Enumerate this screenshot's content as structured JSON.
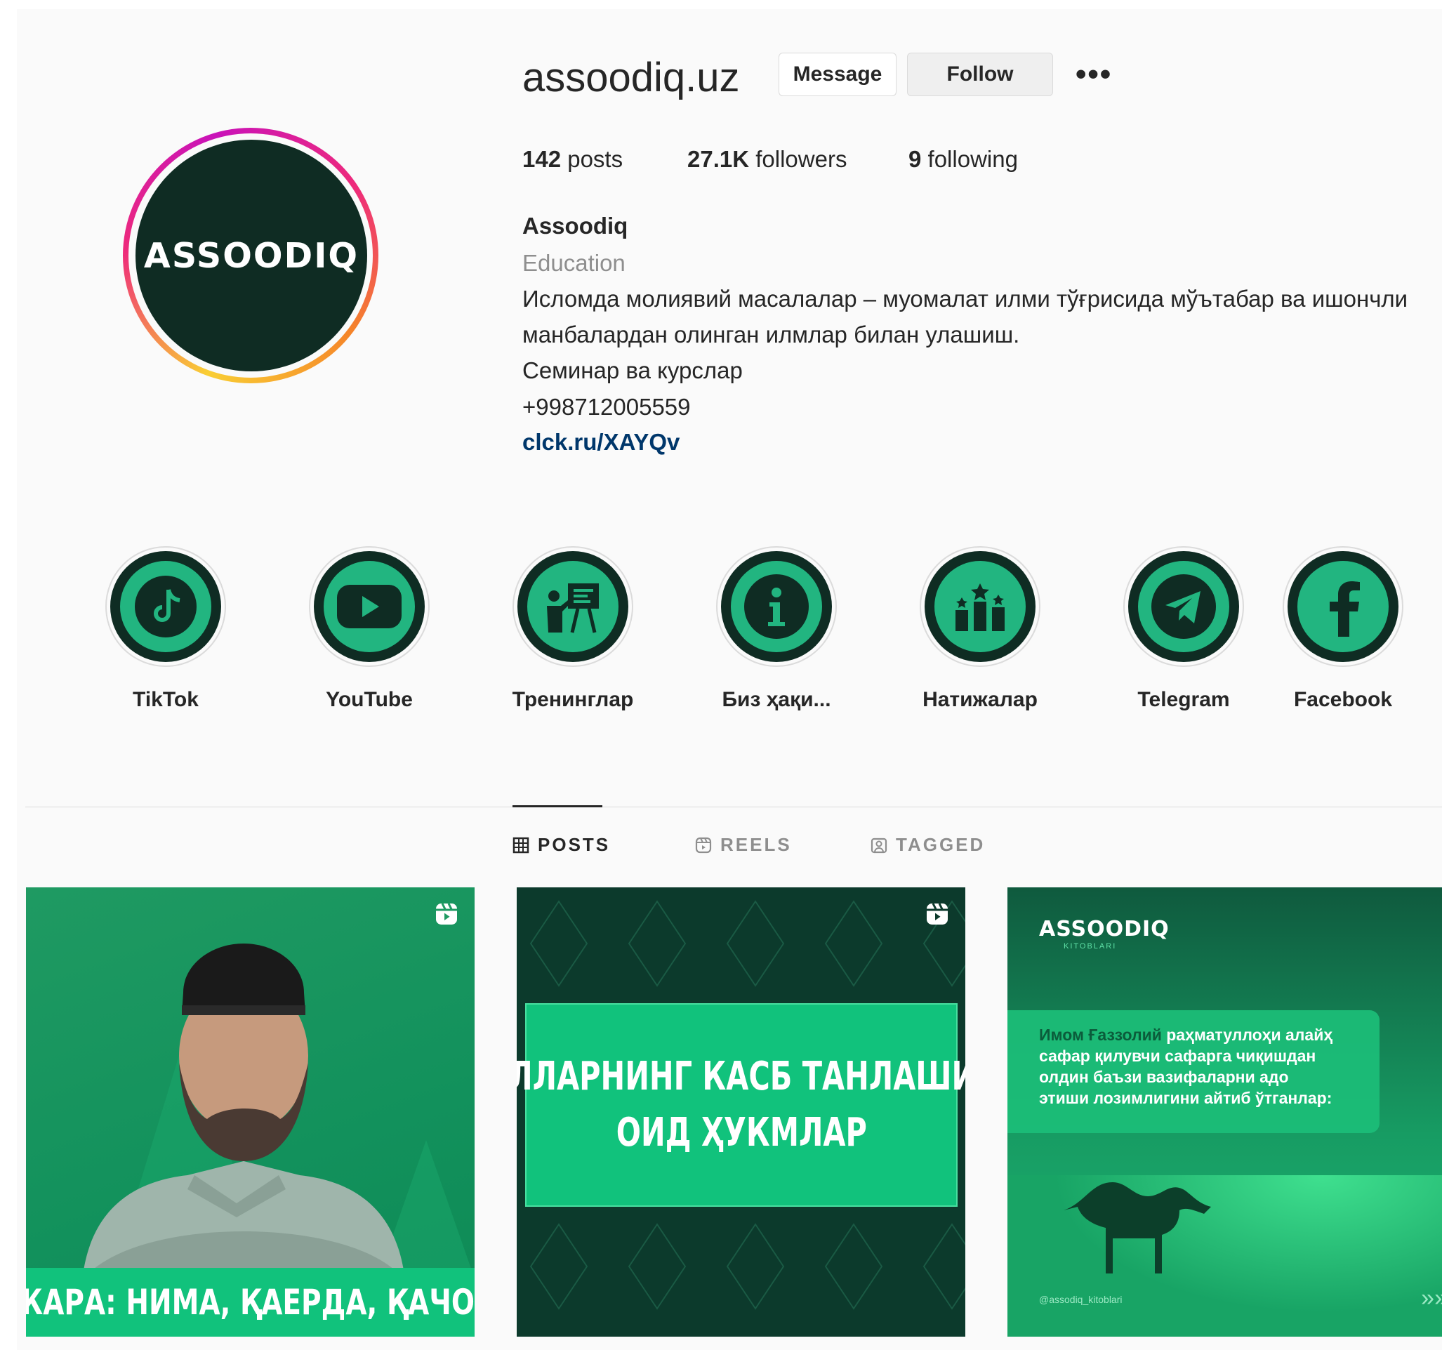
{
  "profile": {
    "username": "assoodiq.uz",
    "avatar_text": "ASSOODIQ",
    "message_label": "Message",
    "follow_label": "Follow",
    "more_label": "•••",
    "posts_count": "142",
    "posts_label": " posts",
    "followers_count": "27.1K",
    "followers_label": " followers",
    "following_count": "9",
    "following_label": " following",
    "full_name": "Assoodiq",
    "category": "Education",
    "bio": [
      "Исломда молиявий масалалар – муомалат илми тўғрисида мўътабар ва ишончли",
      "манбалардан олинган илмлар билан улашиш.",
      "Семинар ва курслар",
      "+998712005559"
    ],
    "link": "clck.ru/XAYQv"
  },
  "highlights": [
    {
      "label": "TikTok",
      "icon": "tiktok-icon"
    },
    {
      "label": "YouTube",
      "icon": "youtube-icon"
    },
    {
      "label": "Тренинглар",
      "icon": "training-icon"
    },
    {
      "label": "Биз ҳақи...",
      "icon": "info-icon"
    },
    {
      "label": "Натижалар",
      "icon": "results-icon"
    },
    {
      "label": "Telegram",
      "icon": "telegram-icon"
    },
    {
      "label": "Facebook",
      "icon": "facebook-icon"
    }
  ],
  "tabs": [
    {
      "label": "POSTS",
      "icon": "grid-icon"
    },
    {
      "label": "REELS",
      "icon": "reels-icon"
    },
    {
      "label": "TAGGED",
      "icon": "tagged-icon"
    }
  ],
  "posts": [
    {
      "caption": "ИЖАРА: НИМА, ҚАЕРДА, ҚАЧОН?"
    },
    {
      "caption_lines": [
        "АЁЛЛАРНИНГ КАСБ ТАНЛАШИГА",
        "ОИД ҲУКМЛАР"
      ]
    },
    {
      "logo": "ASSOODIQ",
      "logo_sub": "KITOBLARI",
      "highlight": "Имом Ғаззолий",
      "lines": [
        "рaҳматуллоҳи алайҳ",
        "сафар қилувчи сафарга чиқишдан",
        "олдин баъзи вазифаларни адо",
        "этиши лозимлигини айтиб ўтганлар:"
      ],
      "handle": "@assodiq_kitoblari",
      "arrows": "»»"
    }
  ]
}
